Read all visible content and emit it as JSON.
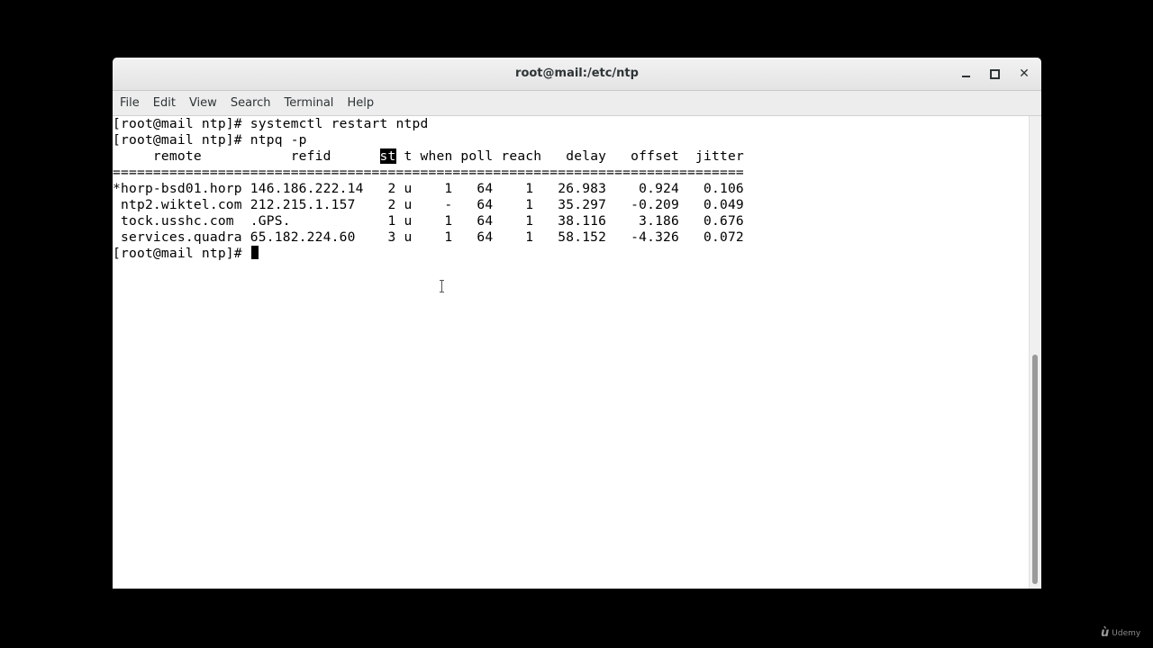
{
  "window": {
    "title": "root@mail:/etc/ntp"
  },
  "menu": {
    "items": [
      "File",
      "Edit",
      "View",
      "Search",
      "Terminal",
      "Help"
    ]
  },
  "terminal": {
    "lines": [
      "[root@mail ntp]# systemctl restart ntpd",
      "[root@mail ntp]# ntpq -p",
      {
        "pre": "     remote           refid      ",
        "hl": "st",
        "post": " t when poll reach   delay   offset  jitter"
      },
      "==============================================================================",
      "*horp-bsd01.horp 146.186.222.14   2 u    1   64    1   26.983    0.924   0.106",
      " ntp2.wiktel.com 212.215.1.157    2 u    -   64    1   35.297   -0.209   0.049",
      " tock.usshc.com  .GPS.            1 u    1   64    1   38.116    3.186   0.676",
      " services.quadra 65.182.224.60    3 u    1   64    1   58.152   -4.326   0.072",
      {
        "prompt": "[root@mail ntp]# "
      }
    ]
  },
  "watermark": {
    "text": "Udemy"
  }
}
